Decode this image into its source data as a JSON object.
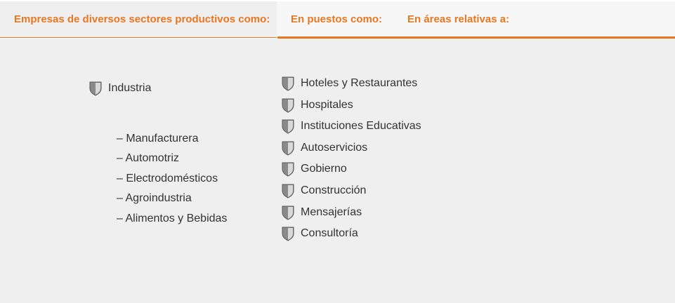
{
  "tabs": {
    "tab1": "Empresas de diversos sectores productivos como:",
    "tab2": "En puestos como:",
    "tab3": "En áreas relativas a:"
  },
  "left": {
    "main": "Industria",
    "subs": [
      "– Manufacturera",
      "– Automotriz",
      "– Electrodomésticos",
      "– Agroindustria",
      "– Alimentos y Bebidas"
    ]
  },
  "right": {
    "items": [
      "Hoteles y Restaurantes",
      "Hospitales",
      "Instituciones Educativas",
      "Autoservicios",
      "Gobierno",
      "Construcción",
      "Mensajerías",
      "Consultoría"
    ]
  },
  "colors": {
    "accent": "#e87722",
    "panel": "#efefef",
    "text": "#333333"
  },
  "icon": "shield-icon"
}
